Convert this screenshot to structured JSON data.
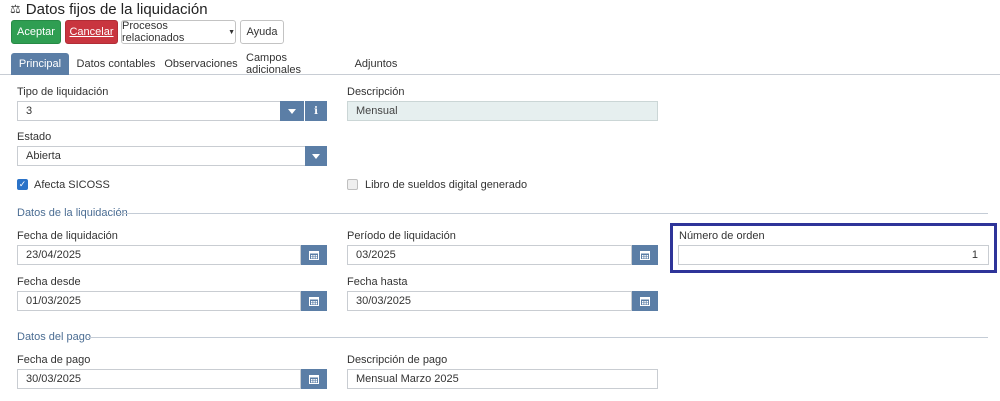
{
  "header": {
    "title": "Datos fijos de la liquidación",
    "title_icon": "balance-scale-icon"
  },
  "toolbar": {
    "aceptar": "Aceptar",
    "cancelar": "Cancelar",
    "procesos": "Procesos relacionados",
    "ayuda": "Ayuda"
  },
  "tabs": [
    {
      "label": "Principal",
      "active": true
    },
    {
      "label": "Datos contables",
      "active": false
    },
    {
      "label": "Observaciones",
      "active": false
    },
    {
      "label": "Campos adicionales",
      "active": false
    },
    {
      "label": "Adjuntos",
      "active": false
    }
  ],
  "principal": {
    "tipo_liquidacion": {
      "label": "Tipo de liquidación",
      "value": "3"
    },
    "descripcion": {
      "label": "Descripción",
      "value": "Mensual"
    },
    "estado": {
      "label": "Estado",
      "value": "Abierta"
    },
    "afecta_sicoss": {
      "label": "Afecta SICOSS",
      "checked": true
    },
    "libro_sueldos": {
      "label": "Libro de sueldos digital generado",
      "checked": false
    }
  },
  "datos_liquidacion": {
    "section_title": "Datos de la liquidación",
    "fecha_liquidacion": {
      "label": "Fecha de liquidación",
      "value": "23/04/2025"
    },
    "periodo_liquidacion": {
      "label": "Período de liquidación",
      "value": "03/2025"
    },
    "numero_orden": {
      "label": "Número de orden",
      "value": "1"
    },
    "fecha_desde": {
      "label": "Fecha desde",
      "value": "01/03/2025"
    },
    "fecha_hasta": {
      "label": "Fecha hasta",
      "value": "30/03/2025"
    }
  },
  "datos_pago": {
    "section_title": "Datos del pago",
    "fecha_pago": {
      "label": "Fecha de pago",
      "value": "30/03/2025"
    },
    "descripcion_pago": {
      "label": "Descripción de pago",
      "value": "Mensual Marzo 2025"
    }
  },
  "colors": {
    "accent": "#5b7ea6",
    "success": "#2f9e52",
    "danger": "#c9353f",
    "highlight": "#2e3499"
  }
}
